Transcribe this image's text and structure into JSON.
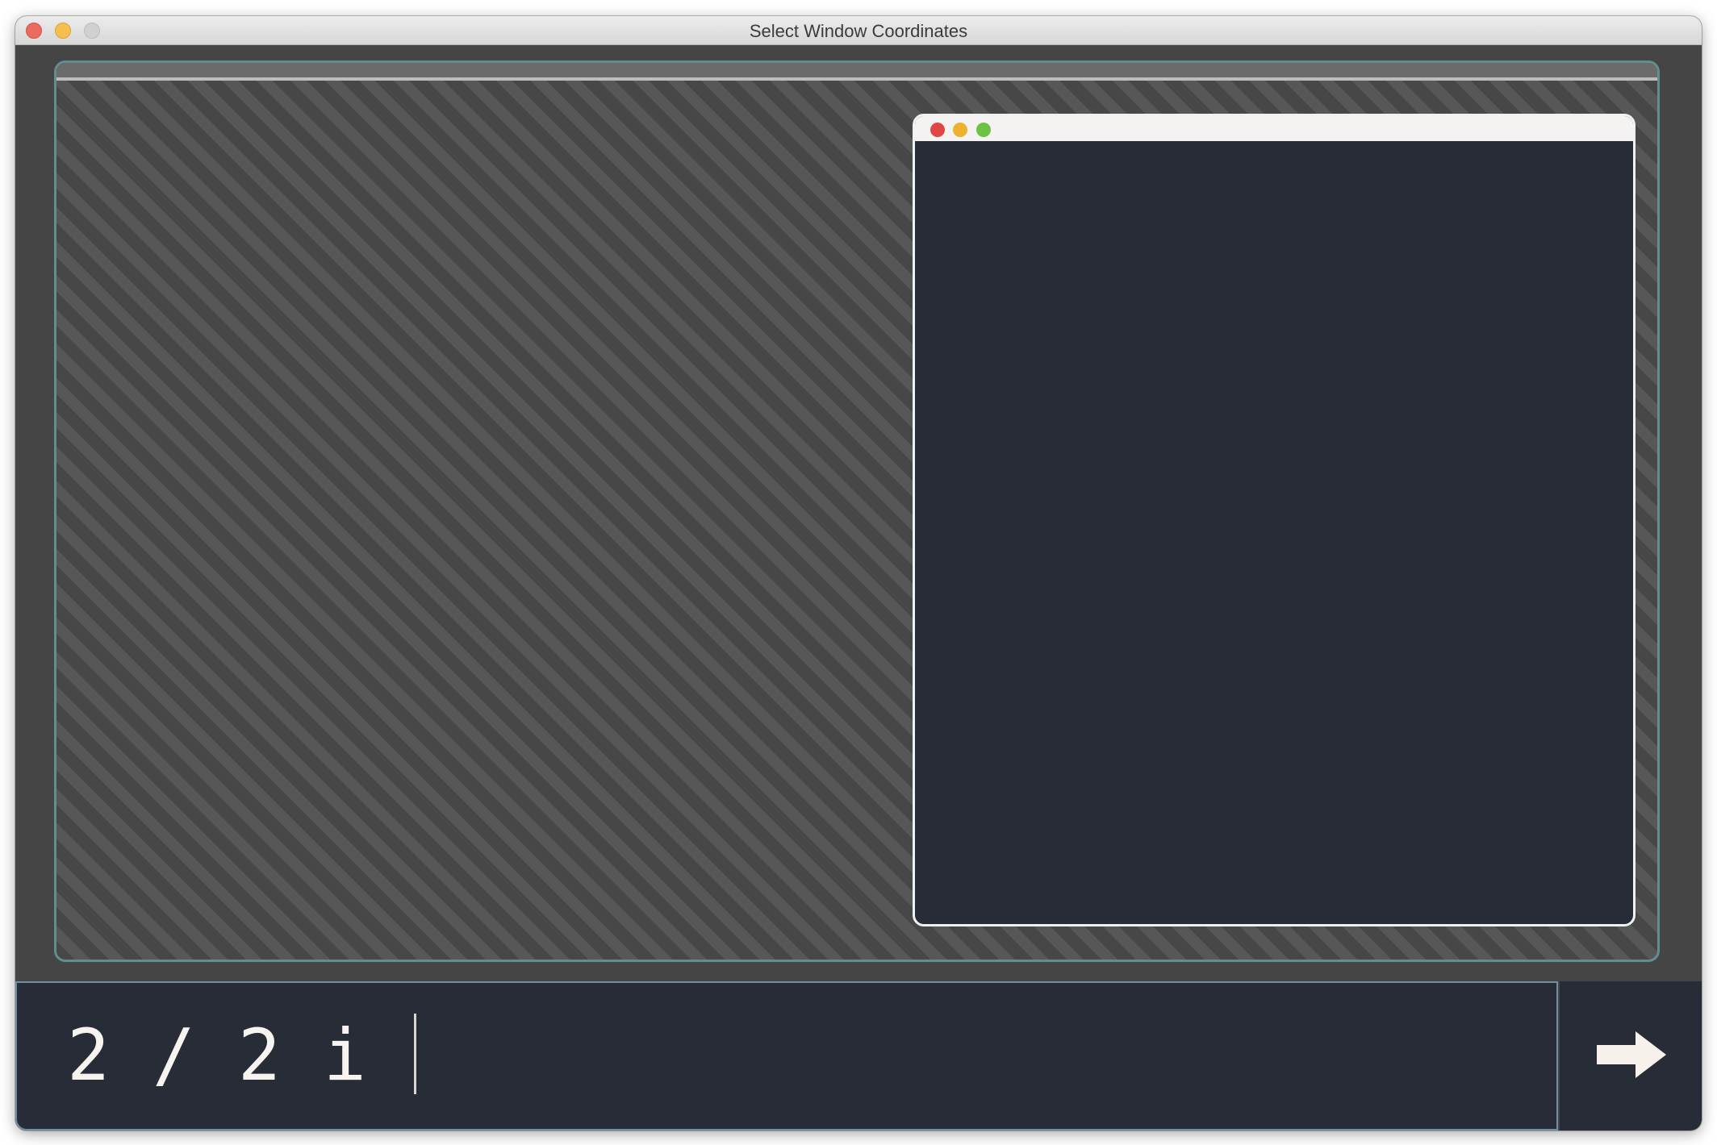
{
  "window": {
    "title": "Select Window Coordinates"
  },
  "canvas": {
    "preview_window": {
      "label": "preview-window"
    }
  },
  "command": {
    "input_value": "2 / 2 i",
    "submit_icon": "arrow-right-icon"
  },
  "colors": {
    "accent_border": "#5f8f90",
    "command_background": "#282c37",
    "preview_body": "#282c37",
    "text": "#f7f4f0"
  }
}
